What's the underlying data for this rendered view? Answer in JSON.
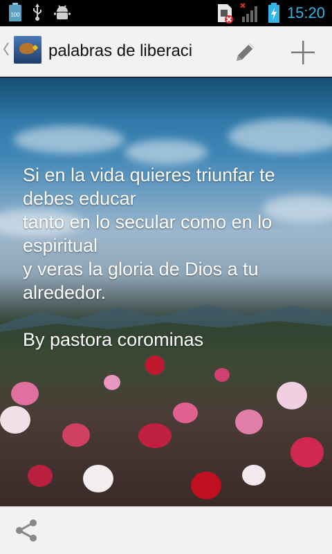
{
  "status_bar": {
    "battery_left_label": "100",
    "time": "15:20",
    "icons": [
      "battery-100-icon",
      "usb-icon",
      "android-debug-icon",
      "no-sim-icon",
      "signal-off-icon",
      "battery-charging-icon"
    ]
  },
  "action_bar": {
    "title": "palabras de liberaci",
    "icons": [
      "up-chevron-icon",
      "app-icon",
      "edit-icon",
      "add-icon"
    ]
  },
  "quote": {
    "lines": [
      "Si en la vida quieres triunfar te debes educar",
      "tanto en lo secular como en lo espiritual",
      "y veras la gloria de Dios a tu alrededor.",
      "",
      "By pastora corominas"
    ]
  },
  "bottom_bar": {
    "icons": [
      "share-icon"
    ]
  },
  "colors": {
    "time": "#33b5e5",
    "actionbar": "#f2f2f2",
    "icon_gray": "#777777"
  }
}
